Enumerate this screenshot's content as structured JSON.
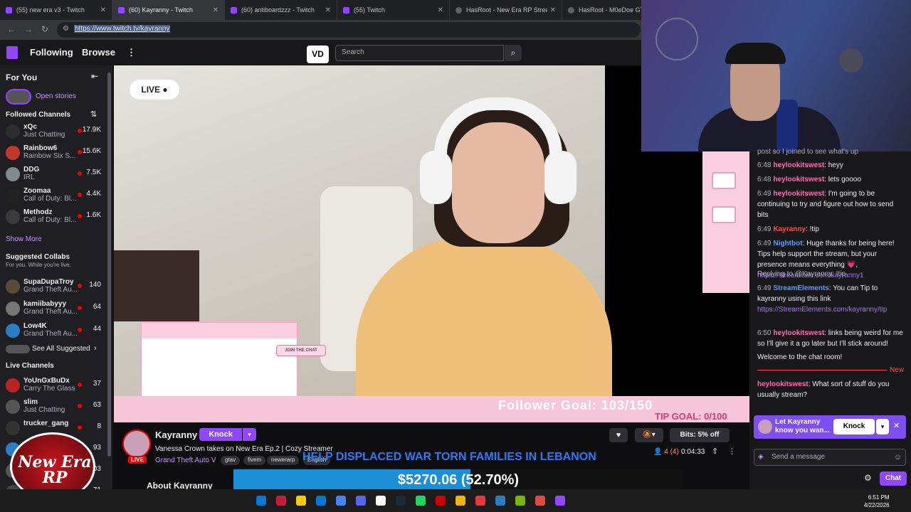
{
  "browser": {
    "tabs": [
      {
        "title": "(55) new era v3 - Twitch",
        "active": false
      },
      {
        "title": "(60) Kayranny - Twitch",
        "active": true
      },
      {
        "title": "(60) antiboardzzz - Twitch",
        "active": false
      },
      {
        "title": "(55) Twitch",
        "active": false
      },
      {
        "title": "HasRoot - New Era RP Stream",
        "active": false
      },
      {
        "title": "HasRoot - M0eDoe GT",
        "active": false
      }
    ],
    "url": "https://www.twitch.tv/kayranny"
  },
  "topnav": {
    "following": "Following",
    "browse": "Browse",
    "search_placeholder": "Search",
    "vd_logo": "VD"
  },
  "sidebar": {
    "for_you": "For You",
    "open_stories": "Open stories",
    "followed_title": "Followed Channels",
    "followed": [
      {
        "name": "xQc",
        "game": "Just Chatting",
        "viewers": "17.9K"
      },
      {
        "name": "Rainbow6",
        "game": "Rainbow Six S...",
        "viewers": "15.6K"
      },
      {
        "name": "DDG",
        "game": "IRL",
        "viewers": "7.5K"
      },
      {
        "name": "Zoomaa",
        "game": "Call of Duty: Bl...",
        "viewers": "4.4K"
      },
      {
        "name": "Methodz",
        "game": "Call of Duty: Bl...",
        "viewers": "1.6K"
      }
    ],
    "show_more": "Show More",
    "suggested_title": "Suggested Collabs",
    "suggested_sub": "For you. While you're live.",
    "suggested": [
      {
        "name": "SupaDupaTroy",
        "game": "Grand Theft Au...",
        "viewers": "140"
      },
      {
        "name": "kamiibabyyy",
        "game": "Grand Theft Au...",
        "viewers": "64"
      },
      {
        "name": "Low4K",
        "game": "Grand Theft Au...",
        "viewers": "44"
      }
    ],
    "see_all": "See All Suggested",
    "live_title": "Live Channels",
    "live": [
      {
        "name": "YoUnGxBuDx",
        "game": "Carry The Glass",
        "viewers": "37"
      },
      {
        "name": "slim",
        "game": "Just Chatting",
        "viewers": "63"
      },
      {
        "name": "trucker_gang",
        "game": "",
        "viewers": "8"
      },
      {
        "name": "",
        "game": "",
        "viewers": "93"
      },
      {
        "name": "",
        "game": "",
        "viewers": "403"
      },
      {
        "name": "",
        "game": "",
        "viewers": "71"
      }
    ]
  },
  "player": {
    "live_badge": "LIVE",
    "join_chat": "JOIN THE CHAT",
    "follower_goal": "Follower Goal: 103/150",
    "tip_goal": "TIP GOAL: 0/100"
  },
  "stream": {
    "streamer": "Kayranny",
    "knock": "Knock",
    "title": "Vanessa Crown takes on New Era Ep.2 | Cozy Streamer",
    "category": "Grand Theft Auto V",
    "tags": [
      "gtav",
      "fivem",
      "newerarp",
      "English"
    ],
    "live_tag": "LIVE",
    "bits": "Bits: 5% off",
    "viewers": "4 (4)",
    "uptime": "0:04:33",
    "about": "About Kayranny"
  },
  "donation": {
    "banner": "HELP DISPLACED WAR TORN FAMILIES IN LEBANON",
    "amount": "$5270.06 (52.70%)",
    "progress": 0.527
  },
  "chat": {
    "partial": "post so I joined to see what's up",
    "messages": [
      {
        "ts": "6:48",
        "user": "heylookitswest",
        "text": "heyy",
        "cls": "u-pink"
      },
      {
        "ts": "6:48",
        "user": "heylookitswest",
        "text": "lets goooo",
        "cls": "u-pink"
      },
      {
        "ts": "6:49",
        "user": "heylookitswest",
        "text": "I'm going to be continuing to try and figure out how to send bits",
        "cls": "u-pink"
      },
      {
        "ts": "6:49",
        "user": "Kayranny",
        "text": "!tip",
        "cls": "u-red"
      },
      {
        "ts": "6:49",
        "user": "Nightbot",
        "text": "Huge thanks for being here! Tips help support the stream, but your presence means everything 💗,",
        "cls": "u-blue",
        "link": "https://streamlabs.com/kayranny1"
      },
      {
        "ts": "6:49",
        "user": "StreamElements",
        "text": "You can Tip to kayranny using this link",
        "cls": "u-blue",
        "link": "https://StreamElements.com/kayranny/tip",
        "reply": "Replying to @Kayranny: !tip"
      },
      {
        "ts": "6:50",
        "user": "heylookitswest",
        "text": "links being weird for me so I'll give it a go later but I'll stick around!",
        "cls": "u-pink"
      }
    ],
    "welcome": "Welcome to the chat room!",
    "new_label": "New",
    "last": {
      "user": "heylookitswest",
      "text": "What sort of stuff do you usually stream?"
    },
    "knock_banner": "Let Kayranny know you wan...",
    "knock_btn": "Knock",
    "send_placeholder": "Send a message",
    "chat_btn": "Chat"
  },
  "overlay_logo": "New Era RP",
  "taskbar": {
    "time": "6:51 PM",
    "date": "4/22/2026"
  }
}
